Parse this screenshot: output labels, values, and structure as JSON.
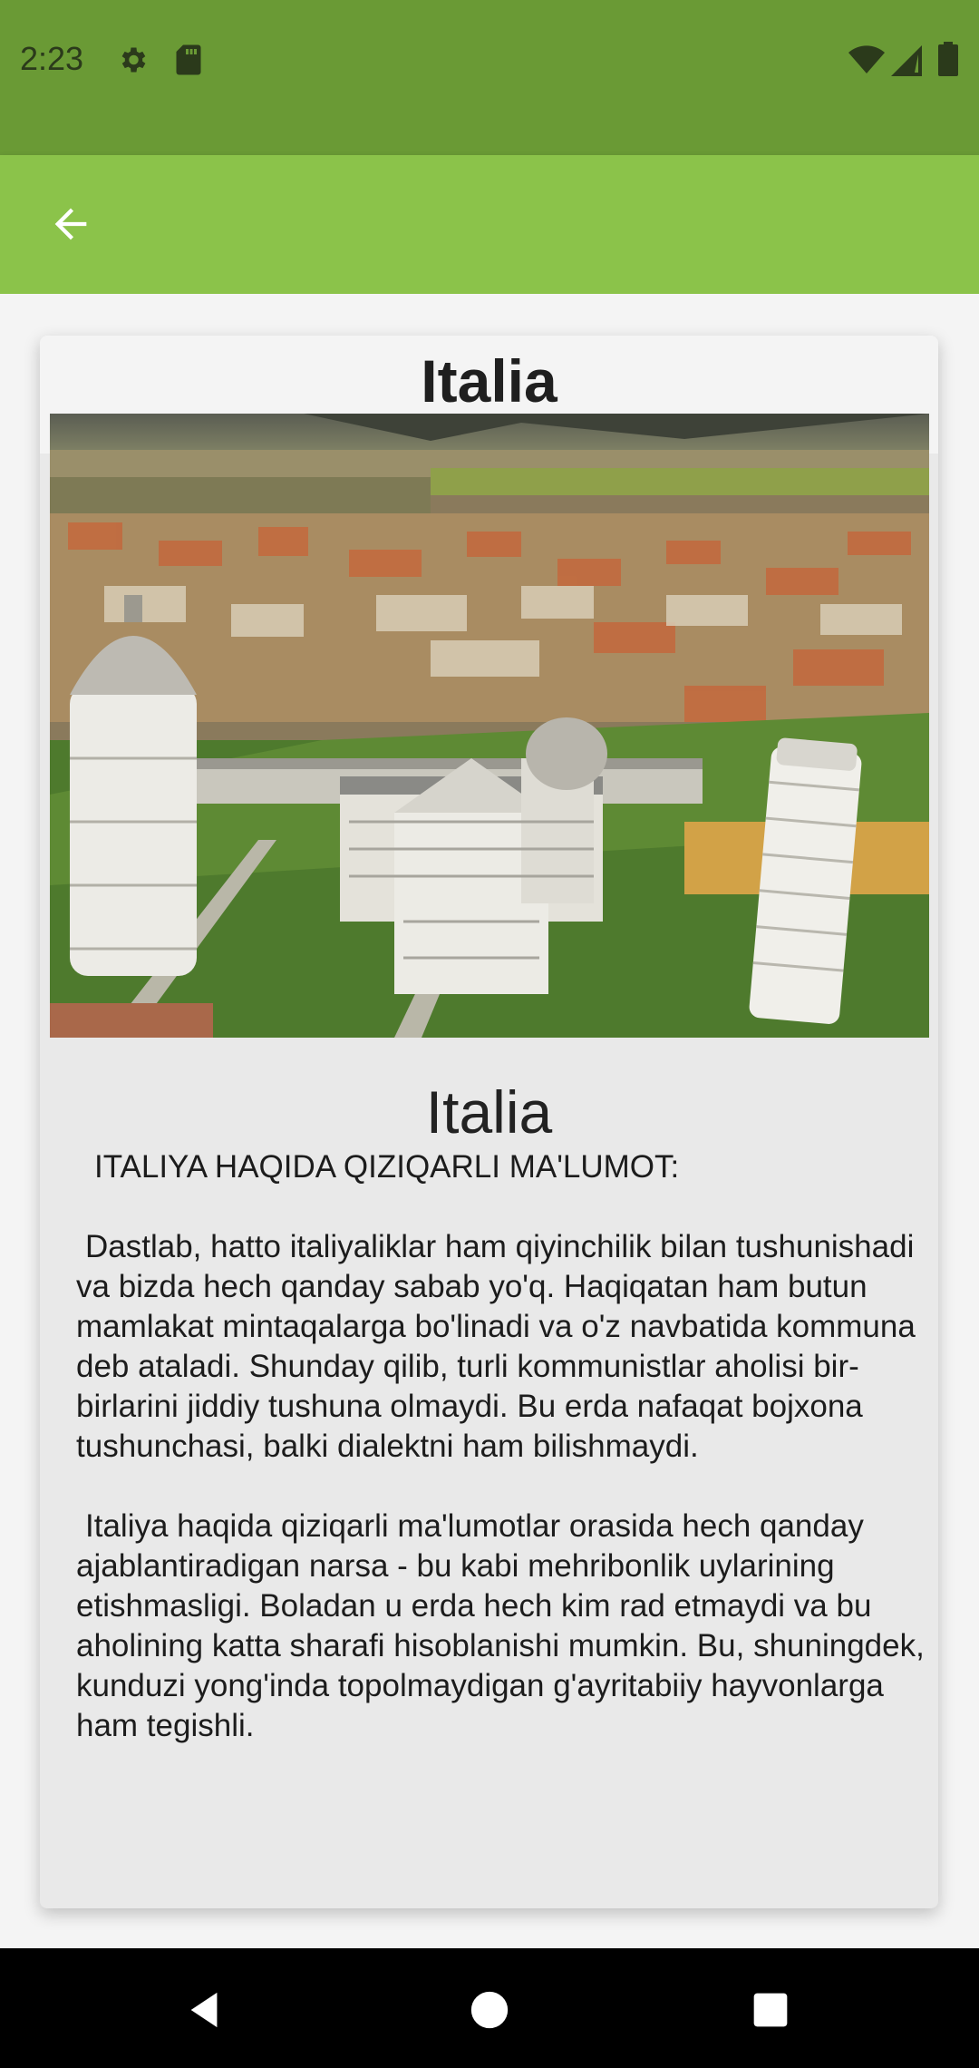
{
  "status_bar": {
    "time": "2:23",
    "icons": [
      "gear-icon",
      "sdcard-icon",
      "wifi-icon",
      "signal-icon",
      "battery-icon"
    ]
  },
  "app_bar": {
    "back_icon": "arrow-left-icon",
    "color": "#8bc34a"
  },
  "card": {
    "title": "Italia",
    "image": "leaning-tower-of-pisa-aerial-photo",
    "image_caption": "Italia",
    "heading": "ITALIYA HAQIDA QIZIQARLI MA'LUMOT:",
    "paragraphs": [
      "Dastlab, hatto italiyaliklar ham qiyinchilik bilan tushunishadi va bizda hech qanday sabab yo'q. Haqiqatan ham butun mamlakat mintaqalarga bo'linadi va o'z navbatida kommuna deb ataladi. Shunday qilib, turli kommunistlar aholisi bir-birlarini jiddiy tushuna olmaydi. Bu erda nafaqat bojxona tushunchasi, balki dialektni ham bilishmaydi.",
      "Italiya haqida qiziqarli ma'lumotlar orasida hech qanday ajablantiradigan narsa - bu kabi mehribonlik uylarining etishmasligi. Boladan u erda hech kim rad etmaydi va bu aholining katta sharafi hisoblanishi mumkin. Bu, shuningdek, kunduzi yong'inda topolmaydigan g'ayritabiiy hayvonlarga ham tegishli."
    ]
  },
  "nav_bar": {
    "buttons": [
      "back-triangle-icon",
      "home-circle-icon",
      "recents-square-icon"
    ]
  },
  "colors": {
    "status_bar": "#6a9a35",
    "app_bar": "#8bc34a",
    "nav_bar": "#000000"
  }
}
